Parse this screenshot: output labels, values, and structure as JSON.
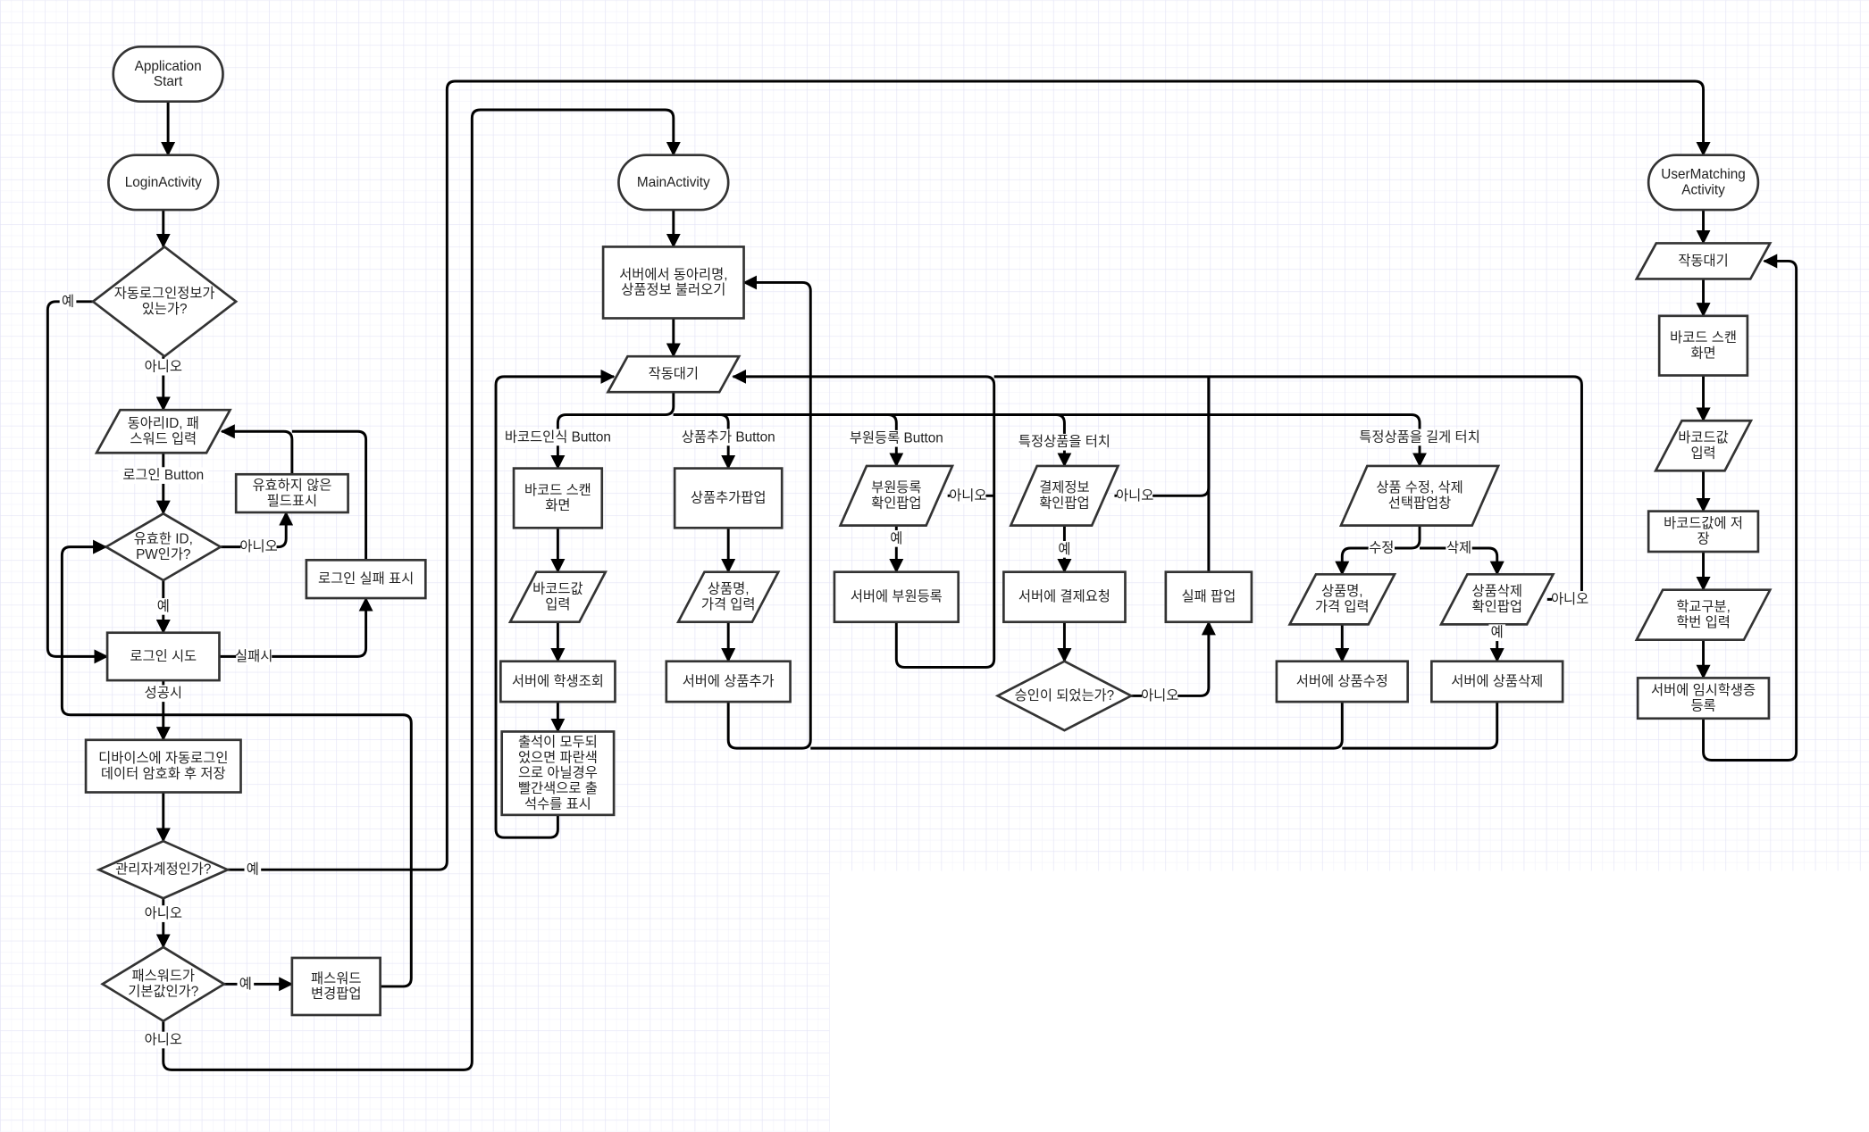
{
  "diagram": {
    "type": "flowchart",
    "colors": {
      "grid_major": "#e4e4f6",
      "grid_minor": "#f0f0fa",
      "stroke": "#000000",
      "shape_fill": "#ffffff"
    },
    "nodes": {
      "app_start": {
        "kind": "terminal",
        "lines": [
          "Application",
          "Start"
        ]
      },
      "login_activity": {
        "kind": "terminal",
        "lines": [
          "LoginActivity"
        ]
      },
      "auto_login_q": {
        "kind": "decision",
        "lines": [
          "자동로그인정보가",
          "있는가?"
        ]
      },
      "id_pw_input": {
        "kind": "io",
        "lines": [
          "동아리ID, 패",
          "스워드 입력"
        ]
      },
      "invalid_field": {
        "kind": "process",
        "lines": [
          "유효하지 않은",
          "필드표시"
        ]
      },
      "valid_q": {
        "kind": "decision",
        "lines": [
          "유효한 ID,",
          "PW인가?"
        ]
      },
      "login_fail": {
        "kind": "process",
        "lines": [
          "로그인 실패 표시"
        ]
      },
      "login_try": {
        "kind": "process",
        "lines": [
          "로그인 시도"
        ]
      },
      "save_auto": {
        "kind": "process",
        "lines": [
          "디바이스에 자동로그인",
          "데이터 암호화 후 저장"
        ]
      },
      "admin_q": {
        "kind": "decision",
        "lines": [
          "관리자계정인가?"
        ]
      },
      "default_pw_q": {
        "kind": "decision",
        "lines": [
          "패스워드가",
          "기본값인가?"
        ]
      },
      "pw_change_popup": {
        "kind": "process",
        "lines": [
          "패스워드",
          "변경팝업"
        ]
      },
      "main_activity": {
        "kind": "terminal",
        "lines": [
          "MainActivity"
        ]
      },
      "load_server": {
        "kind": "process",
        "lines": [
          "서버에서 동아리명,",
          "상품정보 불러오기"
        ]
      },
      "main_wait": {
        "kind": "io",
        "lines": [
          "작동대기"
        ]
      },
      "barcode_scan": {
        "kind": "process",
        "lines": [
          "바코드 스캔",
          "화면"
        ]
      },
      "barcode_input": {
        "kind": "io",
        "lines": [
          "바코드값",
          "입력"
        ]
      },
      "student_lookup": {
        "kind": "process",
        "lines": [
          "서버에 학생조회"
        ]
      },
      "attendance_show": {
        "kind": "process",
        "lines": [
          "출석이 모두되",
          "었으면 파란색",
          "으로 아닐경우",
          "빨간색으로 출",
          "석수를 표시"
        ]
      },
      "add_product_popup": {
        "kind": "process",
        "lines": [
          "상품추가팝업"
        ]
      },
      "product_input": {
        "kind": "io",
        "lines": [
          "상품명,",
          "가격 입력"
        ]
      },
      "server_add_product": {
        "kind": "process",
        "lines": [
          "서버에 상품추가"
        ]
      },
      "member_confirm": {
        "kind": "io",
        "lines": [
          "부원등록",
          "확인팝업"
        ]
      },
      "server_member": {
        "kind": "process",
        "lines": [
          "서버에 부원등록"
        ]
      },
      "payment_confirm": {
        "kind": "io",
        "lines": [
          "결제정보",
          "확인팝업"
        ]
      },
      "server_payment": {
        "kind": "process",
        "lines": [
          "서버에 결제요청"
        ]
      },
      "approved_q": {
        "kind": "decision",
        "lines": [
          "승인이 되었는가?"
        ]
      },
      "fail_popup": {
        "kind": "process",
        "lines": [
          "실패 팝업"
        ]
      },
      "edit_delete_popup": {
        "kind": "io",
        "lines": [
          "상품 수정, 삭제",
          "선택팝업창"
        ]
      },
      "edit_input": {
        "kind": "io",
        "lines": [
          "상품명,",
          "가격 입력"
        ]
      },
      "delete_confirm": {
        "kind": "io",
        "lines": [
          "상품삭제",
          "확인팝업"
        ]
      },
      "server_edit": {
        "kind": "process",
        "lines": [
          "서버에 상품수정"
        ]
      },
      "server_delete": {
        "kind": "process",
        "lines": [
          "서버에 상품삭제"
        ]
      },
      "usermatching_activity": {
        "kind": "terminal",
        "lines": [
          "UserMatching",
          "Activity"
        ]
      },
      "um_wait": {
        "kind": "io",
        "lines": [
          "작동대기"
        ]
      },
      "um_barcode_scan": {
        "kind": "process",
        "lines": [
          "바코드 스캔",
          "화면"
        ]
      },
      "um_barcode_input": {
        "kind": "io",
        "lines": [
          "바코드값",
          "입력"
        ]
      },
      "um_barcode_save": {
        "kind": "process",
        "lines": [
          "바코드값에 저",
          "장"
        ]
      },
      "um_school_input": {
        "kind": "io",
        "lines": [
          "학교구분,",
          "학번 입력"
        ]
      },
      "um_temp_register": {
        "kind": "process",
        "lines": [
          "서버에 임시학생증",
          "등록"
        ]
      }
    },
    "edge_labels": {
      "yes": "예",
      "no": "아니오",
      "login_button": "로그인 Button",
      "on_fail": "실패시",
      "on_success": "성공시",
      "barcode_button": "바코드인식 Button",
      "add_product_button": "상품추가 Button",
      "member_button": "부원등록 Button",
      "touch_product": "특정상품을 터치",
      "long_touch_product": "특정상품을 길게 터치",
      "edit": "수정",
      "delete": "삭제"
    }
  }
}
